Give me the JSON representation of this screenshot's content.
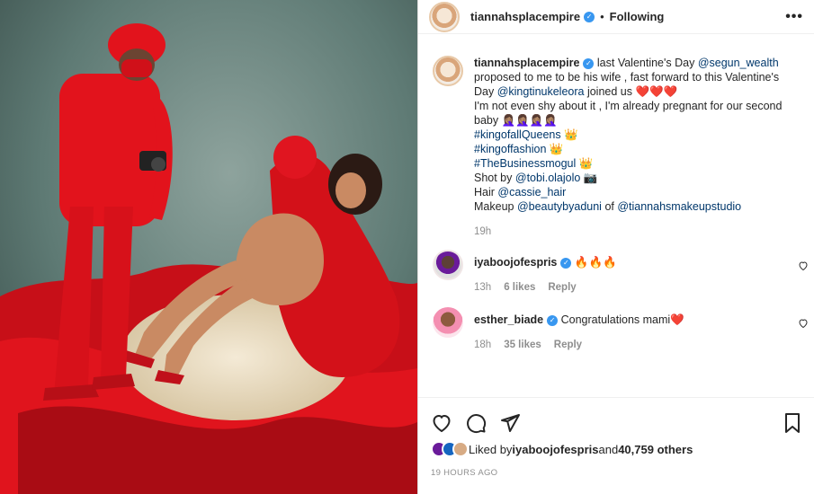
{
  "header": {
    "username": "tiannahsplacempire",
    "verified": true,
    "separator": "•",
    "follow_label": "Following",
    "more_label": "•••"
  },
  "caption": {
    "username": "tiannahsplacempire",
    "lines": [
      {
        "pre": "last Valentine's Day ",
        "link": "@segun_wealth"
      },
      {
        "text": "proposed to me to be his wife , fast forward to this Valentine's"
      },
      {
        "pre": "Day ",
        "link": "@kingtinukeleora",
        "post": " joined us ❤️❤️❤️"
      },
      {
        "text": "I'm not even shy about it , I'm already pregnant for our second"
      },
      {
        "text": "baby 🤦🏽‍♀️🤦🏽‍♀️🤦🏽‍♀️🤦🏽‍♀️"
      }
    ],
    "hashtags": [
      {
        "tag": "#kingofallQueens",
        "emoji": " 👑"
      },
      {
        "tag": "#kingoffashion",
        "emoji": " 👑"
      },
      {
        "tag": "#TheBusinessmogul",
        "emoji": " 👑"
      }
    ],
    "credits": [
      {
        "pre": "Shot by ",
        "link": "@tobi.olajolo",
        "post": " 📷"
      },
      {
        "pre": "Hair ",
        "link": "@cassie_hair",
        "post": ""
      },
      {
        "pre": "Makeup ",
        "link": "@beautybyaduni",
        "post": " of ",
        "link2": "@tiannahsmakeupstudio"
      }
    ],
    "time": "19h"
  },
  "comments": [
    {
      "username": "iyaboojofespris",
      "verified": true,
      "text": "🔥🔥🔥",
      "time": "13h",
      "likes": "6 likes",
      "reply": "Reply"
    },
    {
      "username": "esther_biade",
      "verified": true,
      "text": "Congratulations mami❤️",
      "time": "18h",
      "likes": "35 likes",
      "reply": "Reply"
    }
  ],
  "likes": {
    "prefix": "Liked by ",
    "user": "iyaboojofespris",
    "middle": " and ",
    "count": "40,759 others"
  },
  "timestamp": "19 HOURS AGO",
  "colors": {
    "link": "#00376b",
    "verified": "#3897f0",
    "muted": "#8e8e8e",
    "photo_red": "#d8131c",
    "photo_backdrop": "#5e7a74"
  },
  "icons": [
    "more-icon",
    "heart-icon",
    "comment-icon",
    "share-icon",
    "save-icon",
    "verified-icon"
  ]
}
